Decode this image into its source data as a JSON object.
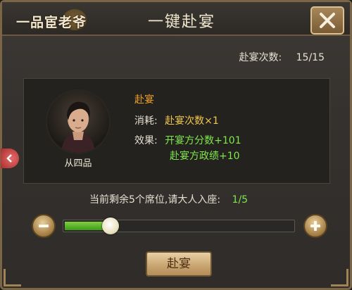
{
  "logo_text": "一品宦老爷",
  "title": "一键赴宴",
  "close_icon": "close-x-icon",
  "count": {
    "label": "赴宴次数:",
    "value": "15/15"
  },
  "character": {
    "rank": "从四品"
  },
  "info": {
    "title": "赴宴",
    "cost_label": "消耗:",
    "cost_value": "赴宴次数×1",
    "effect_label": "效果:",
    "effect_1": "开宴方分数+101",
    "effect_2": "赴宴方政绩+10"
  },
  "seats": {
    "text": "当前剩余5个席位,请大人入座:",
    "current": "1/5"
  },
  "slider": {
    "value": 1,
    "max": 5
  },
  "buttons": {
    "minus": "minus-icon",
    "plus": "plus-icon",
    "go_label": "赴宴"
  },
  "colors": {
    "orange": "#f0a020",
    "yellow": "#f0c84a",
    "green": "#7ee84b",
    "gold": "#c8a36f"
  }
}
